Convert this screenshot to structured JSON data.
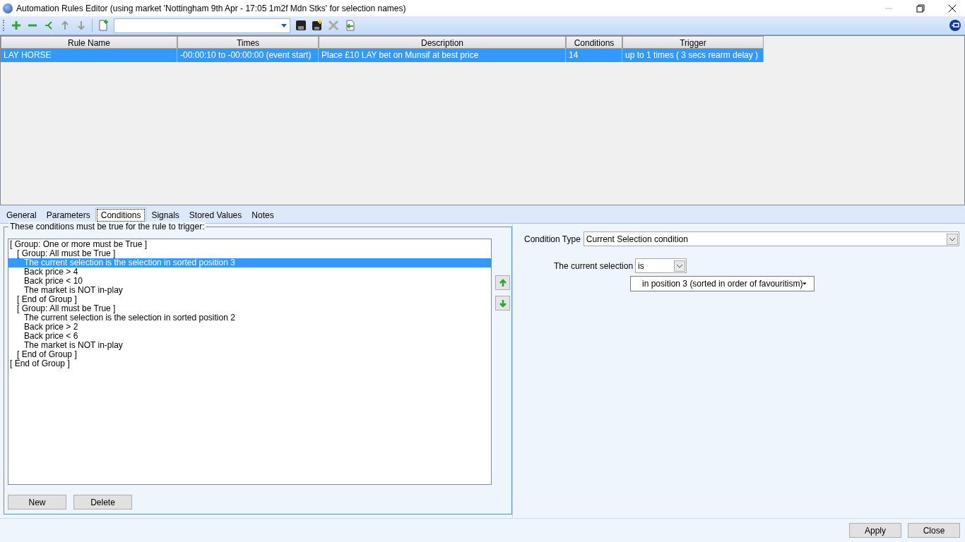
{
  "window": {
    "title": "Automation Rules Editor (using market 'Nottingham 9th Apr - 17:05 1m2f Mdn Stks' for selection names)"
  },
  "rules_table": {
    "columns": [
      "Rule Name",
      "Times",
      "Description",
      "Conditions",
      "Trigger"
    ],
    "rows": [
      {
        "selected": true,
        "cells": [
          "LAY HORSE",
          "-00:00:10 to -00:00:00 (event start)",
          "Place £10 LAY bet on Munsif at best price",
          "14",
          "up to 1 times ( 3 secs rearm delay )"
        ]
      }
    ]
  },
  "tabs": [
    {
      "label": "General",
      "selected": false
    },
    {
      "label": "Parameters",
      "selected": false
    },
    {
      "label": "Conditions",
      "selected": true
    },
    {
      "label": "Signals",
      "selected": false
    },
    {
      "label": "Stored Values",
      "selected": false
    },
    {
      "label": "Notes",
      "selected": false
    }
  ],
  "conditions": {
    "title": "These conditions must be true for the rule to trigger:",
    "tree": [
      {
        "label": "[ Group: One or more must be True ]",
        "selected": false,
        "end_label": "[ End of Group ]",
        "children": [
          {
            "label": "[ Group: All must be True ]",
            "selected": false,
            "end_label": "[ End of Group ]",
            "children": [
              {
                "label": "The current selection is the selection in sorted position 3",
                "selected": true
              },
              {
                "label": "Back price > 4",
                "selected": false
              },
              {
                "label": "Back price < 10",
                "selected": false
              },
              {
                "label": "The market is NOT in-play",
                "selected": false
              }
            ]
          },
          {
            "label": "[ Group: All must be True ]",
            "selected": false,
            "end_label": "[ End of Group ]",
            "children": [
              {
                "label": "The current selection is the selection in sorted position 2",
                "selected": false
              },
              {
                "label": "Back price > 2",
                "selected": false
              },
              {
                "label": "Back price < 6",
                "selected": false
              },
              {
                "label": "The market is NOT in-play",
                "selected": false
              }
            ]
          }
        ]
      }
    ],
    "buttons": [
      "New",
      "Delete"
    ]
  },
  "condition_editor": {
    "type_label": "Condition Type",
    "type_value": "Current Selection condition",
    "selection_label": "The current selection",
    "operator": "is",
    "position": "in position 3 (sorted in order of favouritism)"
  },
  "footer_buttons": [
    "Apply",
    "Close"
  ]
}
